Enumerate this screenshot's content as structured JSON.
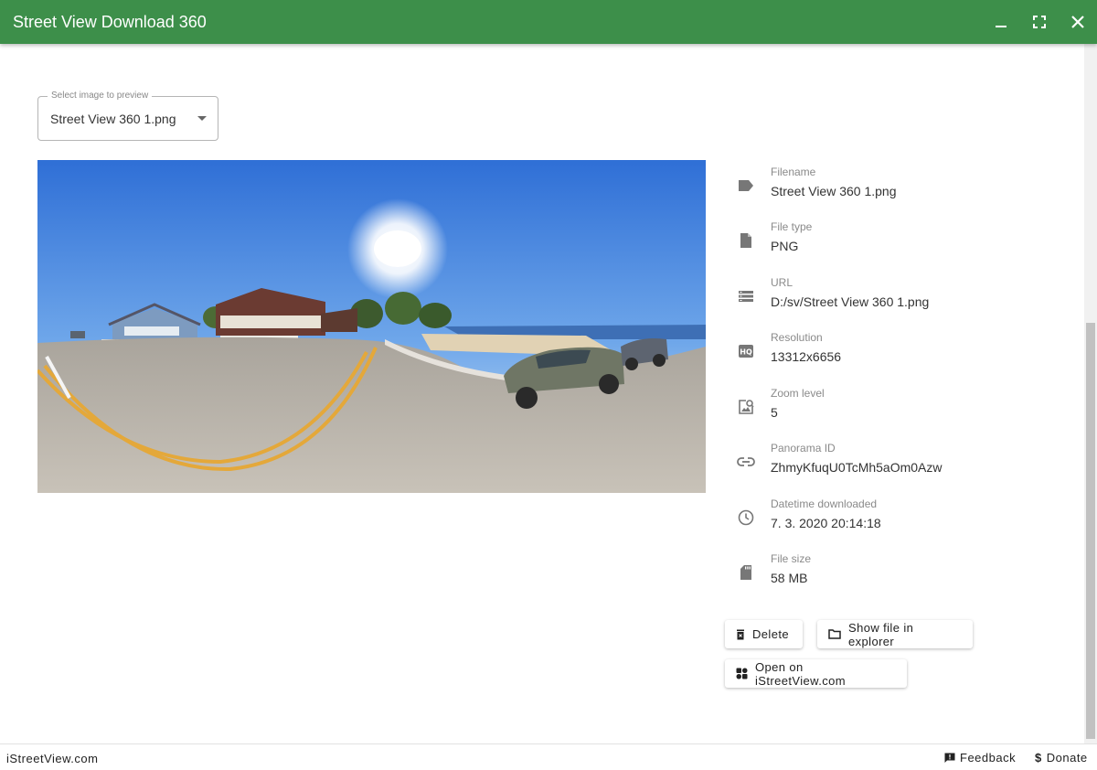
{
  "window": {
    "title": "Street View Download 360"
  },
  "preview_select": {
    "legend": "Select image to preview",
    "value": "Street View 360 1.png"
  },
  "info": [
    {
      "icon": "tag-icon",
      "label": "Filename",
      "value": "Street View 360 1.png"
    },
    {
      "icon": "file-icon",
      "label": "File type",
      "value": "PNG"
    },
    {
      "icon": "storage-icon",
      "label": "URL",
      "value": "D:/sv/Street View 360 1.png"
    },
    {
      "icon": "hq-icon",
      "label": "Resolution",
      "value": "13312x6656"
    },
    {
      "icon": "image-search-icon",
      "label": "Zoom level",
      "value": "5"
    },
    {
      "icon": "link-icon",
      "label": "Panorama ID",
      "value": "ZhmyKfuqU0TcMh5aOm0Azw"
    },
    {
      "icon": "clock-icon",
      "label": "Datetime downloaded",
      "value": "7. 3. 2020 20:14:18"
    },
    {
      "icon": "sd-card-icon",
      "label": "File size",
      "value": "58 MB"
    }
  ],
  "actions": {
    "delete": "Delete",
    "show_in_explorer": "Show file in explorer",
    "open_on_site": "Open on iStreetView.com"
  },
  "footer": {
    "site": "iStreetView.com",
    "feedback": "Feedback",
    "donate": "Donate"
  },
  "colors": {
    "titlebar": "#3d8f4a",
    "icon_gray": "#7a7a7a"
  }
}
